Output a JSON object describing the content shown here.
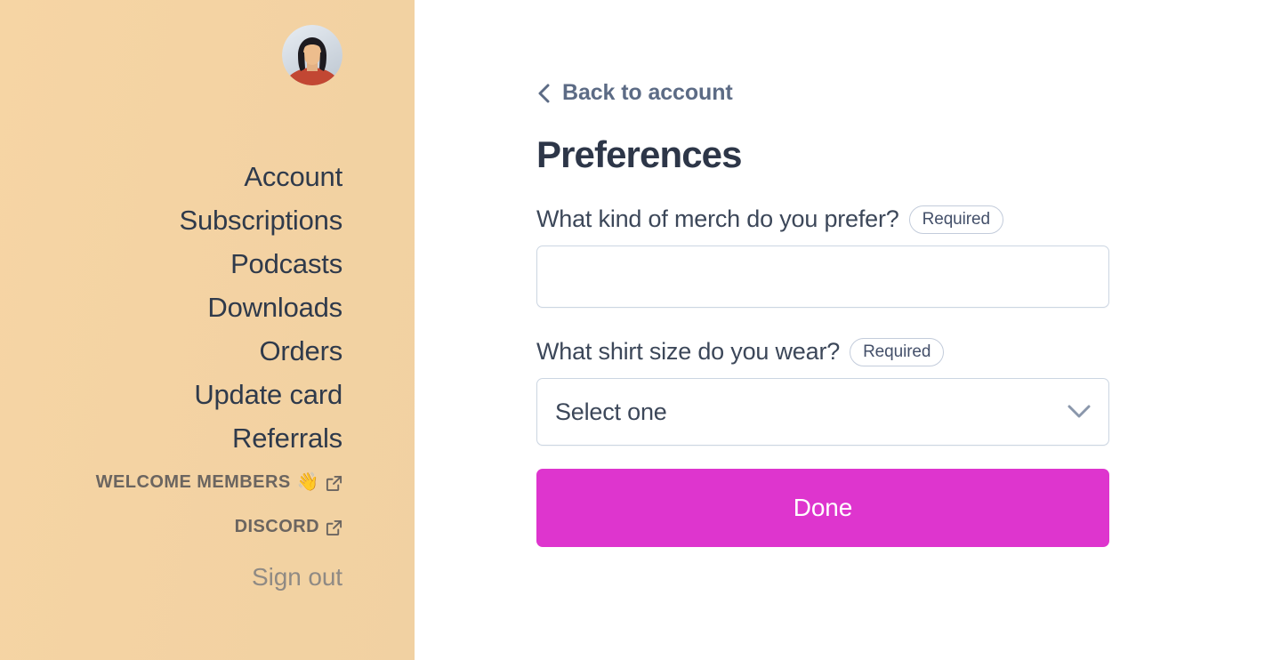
{
  "sidebar": {
    "avatar_alt": "user-avatar",
    "nav_items": [
      {
        "label": "Account",
        "type": "link"
      },
      {
        "label": "Subscriptions",
        "type": "link"
      },
      {
        "label": "Podcasts",
        "type": "link"
      },
      {
        "label": "Downloads",
        "type": "link"
      },
      {
        "label": "Orders",
        "type": "link"
      },
      {
        "label": "Update card",
        "type": "link"
      },
      {
        "label": "Referrals",
        "type": "link"
      }
    ],
    "external_items": [
      {
        "label": "WELCOME MEMBERS",
        "emoji": "👋",
        "icon": "external-link-icon"
      },
      {
        "label": "DISCORD",
        "emoji": "",
        "icon": "external-link-icon"
      }
    ],
    "sign_out_label": "Sign out",
    "bg_color_start": "#f6d5a4",
    "bg_color_end": "#f1d1a2",
    "text_color": "#2f3a4b",
    "muted_text_color": "#8f8a84"
  },
  "main": {
    "back_link": {
      "label": "Back to account",
      "icon": "chevron-left-icon"
    },
    "title": "Preferences",
    "fields": [
      {
        "question": "What kind of merch do you prefer?",
        "badge": "Required",
        "control": "textarea",
        "value": "",
        "placeholder": ""
      },
      {
        "question": "What shirt size do you wear?",
        "badge": "Required",
        "control": "select",
        "value": "Select one",
        "icon": "chevron-down-icon"
      }
    ],
    "submit_label": "Done",
    "submit_color": "#de35ce",
    "heading_color": "#2d3648",
    "back_link_color": "#5c6b85"
  }
}
